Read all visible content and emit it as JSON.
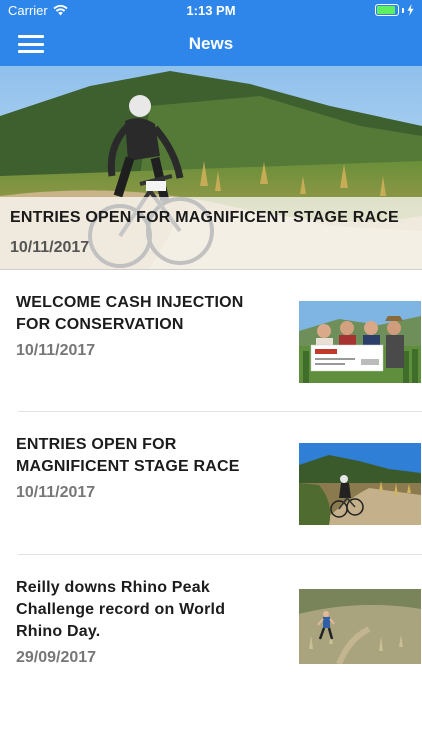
{
  "status_bar": {
    "carrier": "Carrier",
    "time": "1:13 PM",
    "battery_level": 0.9,
    "icons": [
      "wifi-icon",
      "battery-icon",
      "charging-bolt-icon"
    ]
  },
  "nav_bar": {
    "title": "News",
    "menu_icon": "hamburger-menu-icon",
    "background_color": "#2f86ea"
  },
  "featured": {
    "title": "ENTRIES OPEN FOR MAGNIFICENT STAGE RACE",
    "date": "10/11/2017",
    "image": "mountain-bike-rider-photo"
  },
  "news_items": [
    {
      "title": "WELCOME CASH INJECTION FOR CONSERVATION",
      "date": "10/11/2017",
      "image": "cheque-handover-photo"
    },
    {
      "title": "ENTRIES OPEN FOR MAGNIFICENT STAGE RACE",
      "date": "10/11/2017",
      "image": "mountain-bike-trail-photo"
    },
    {
      "title": "Reilly downs Rhino Peak Challenge record on World Rhino Day.",
      "date": "29/09/2017",
      "image": "trail-runner-photo"
    }
  ]
}
